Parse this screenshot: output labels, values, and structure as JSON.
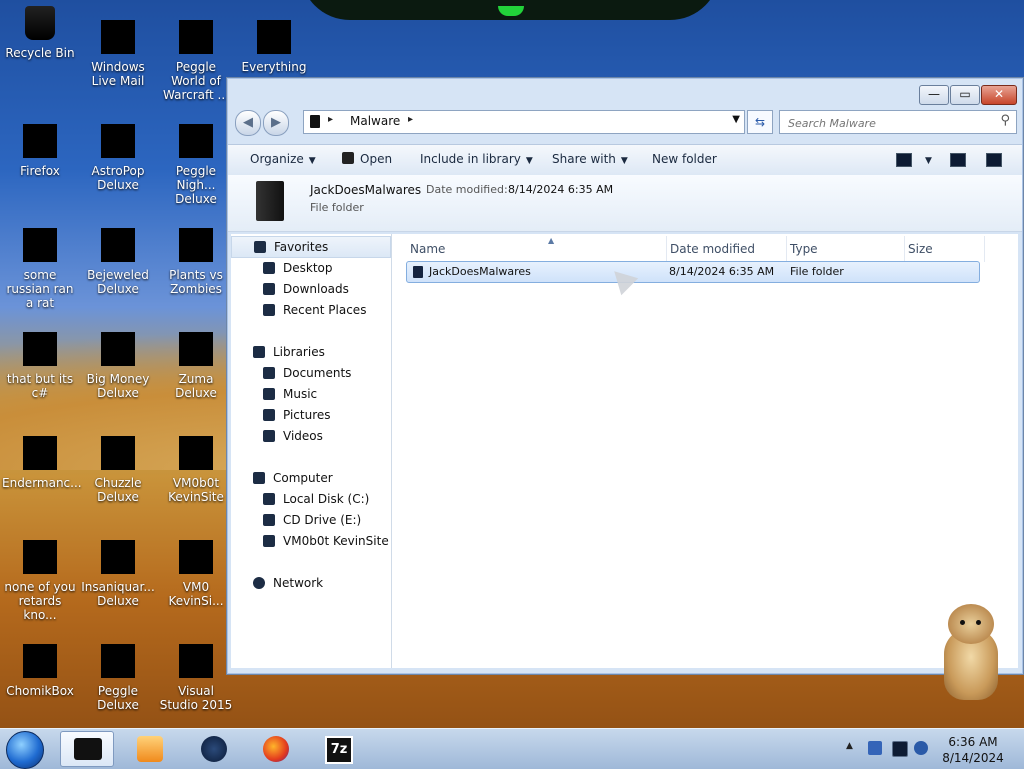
{
  "desktop_icons": [
    {
      "label": "Recycle Bin",
      "icon": "recycle-bin-icon"
    },
    {
      "label": "Windows Live Mail",
      "icon": "mail-icon"
    },
    {
      "label": "Peggle World of Warcraft ...",
      "icon": "game-icon"
    },
    {
      "label": "Everything",
      "icon": "search-app-icon"
    },
    {
      "label": "Firefox",
      "icon": "firefox-icon"
    },
    {
      "label": "AstroPop Deluxe",
      "icon": "game-icon"
    },
    {
      "label": "Peggle Nigh... Deluxe",
      "icon": "game-icon"
    },
    {
      "label": "some russian ran a rat",
      "icon": "app-icon"
    },
    {
      "label": "Bejeweled Deluxe",
      "icon": "game-icon"
    },
    {
      "label": "Plants vs Zombies",
      "icon": "game-icon"
    },
    {
      "label": "that but its c#",
      "icon": "app-icon"
    },
    {
      "label": "Big Money Deluxe",
      "icon": "game-icon"
    },
    {
      "label": "Zuma Deluxe",
      "icon": "game-icon"
    },
    {
      "label": "Endermanc...",
      "icon": "app-icon"
    },
    {
      "label": "Chuzzle Deluxe",
      "icon": "game-icon"
    },
    {
      "label": "VM0b0t KevinSite",
      "icon": "app-icon"
    },
    {
      "label": "none of you retards kno...",
      "icon": "app-icon"
    },
    {
      "label": "Insaniquar... Deluxe",
      "icon": "game-icon"
    },
    {
      "label": "VM0 KevinSi...",
      "icon": "app-icon"
    },
    {
      "label": "ChomikBox",
      "icon": "app-icon"
    },
    {
      "label": "Peggle Deluxe",
      "icon": "game-icon"
    },
    {
      "label": "Visual Studio 2015",
      "icon": "visual-studio-icon"
    }
  ],
  "window": {
    "controls": {
      "minimize": "—",
      "maximize": "▭",
      "close": "✕"
    },
    "address": {
      "crumbs": [
        "Malware"
      ],
      "sep": "▸"
    },
    "search": {
      "placeholder": "Search Malware"
    },
    "toolbar": {
      "organize": "Organize",
      "open": "Open",
      "include_in_library": "Include in library",
      "share_with": "Share with",
      "new_folder": "New folder"
    },
    "details": {
      "name": "JackDoesMalwares",
      "date_modified_label": "Date modified:",
      "date_modified_value": "8/14/2024 6:35 AM",
      "type": "File folder"
    },
    "nav_pane": {
      "favorites": "Favorites",
      "desktop": "Desktop",
      "downloads": "Downloads",
      "recent_places": "Recent Places",
      "libraries": "Libraries",
      "documents": "Documents",
      "music": "Music",
      "pictures": "Pictures",
      "videos": "Videos",
      "computer": "Computer",
      "local_disk": "Local Disk (C:)",
      "cd_drive": "CD Drive (E:)",
      "vm_site": "VM0b0t KevinSite",
      "network": "Network"
    },
    "columns": {
      "name": "Name",
      "date_modified": "Date modified",
      "type": "Type",
      "size": "Size"
    },
    "rows": [
      {
        "name": "JackDoesMalwares",
        "date": "8/14/2024 6:35 AM",
        "type": "File folder",
        "size": ""
      }
    ]
  },
  "taskbar": {
    "clock_time": "6:36 AM",
    "clock_date": "8/14/2024",
    "apps": [
      {
        "name": "explorer",
        "icon": "folder-icon",
        "active": true
      },
      {
        "name": "media-player",
        "icon": "media-player-icon"
      },
      {
        "name": "network-globe",
        "icon": "globe-icon"
      },
      {
        "name": "firefox",
        "icon": "firefox-icon"
      },
      {
        "name": "7zip",
        "icon": "7zip-icon",
        "label": "7z"
      }
    ],
    "tray_caret": "▲"
  },
  "colors": {
    "selection_fill": "#cfe2fa",
    "selection_border": "#84aedf",
    "close_button": "#c7452a",
    "taskbar": "#9fb8d8"
  }
}
